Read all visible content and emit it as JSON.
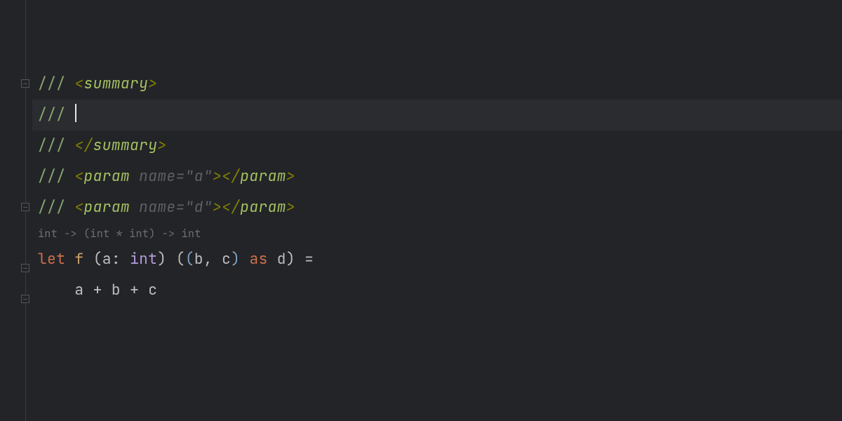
{
  "editor": {
    "doc_slash": "///",
    "space": " ",
    "xml": {
      "lt": "<",
      "gt": ">",
      "slash": "/",
      "summary": "summary",
      "param": "param",
      "name_attr": " name=",
      "quote": "\"",
      "param_a": "a",
      "param_d": "d",
      "close": ">"
    },
    "inlay_type": "int -> (int * int) -> int",
    "code": {
      "let": "let",
      "fname": "f",
      "lp": "(",
      "rp": ")",
      "a": "a",
      "colon": ":",
      "int": "int",
      "b": "b",
      "c": "c",
      "comma": ",",
      "as": "as",
      "d": "d",
      "eq": "=",
      "plus": "+",
      "indent": "    "
    }
  }
}
